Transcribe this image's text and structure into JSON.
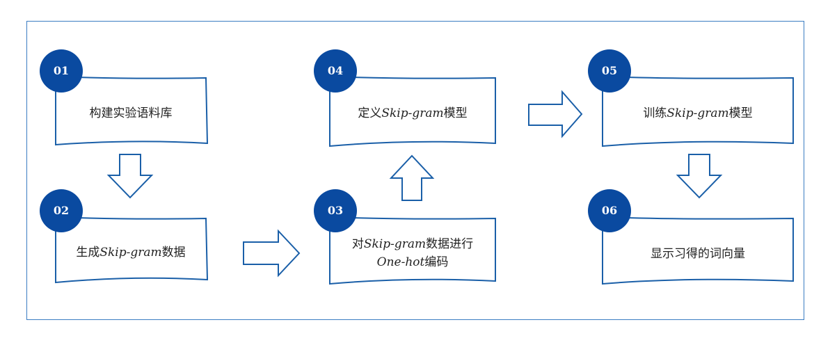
{
  "steps": [
    {
      "num": "01",
      "text": "构建实验语料库"
    },
    {
      "num": "02",
      "text_pre": "生成",
      "text_em": "Skip-gram",
      "text_post": "数据"
    },
    {
      "num": "03",
      "line1_pre": "对",
      "line1_em": "Skip-gram",
      "line1_post": "数据进行",
      "line2_em": "One-hot",
      "line2_post": "编码"
    },
    {
      "num": "04",
      "text_pre": "定义",
      "text_em": "Skip-gram",
      "text_post": "模型"
    },
    {
      "num": "05",
      "text_pre": "训练",
      "text_em": "Skip-gram",
      "text_post": "模型"
    },
    {
      "num": "06",
      "text": "显示习得的词向量"
    }
  ],
  "colors": {
    "circle": "#0a4aa0",
    "stroke": "#1a5fa8",
    "frame": "#3a7cc2"
  }
}
